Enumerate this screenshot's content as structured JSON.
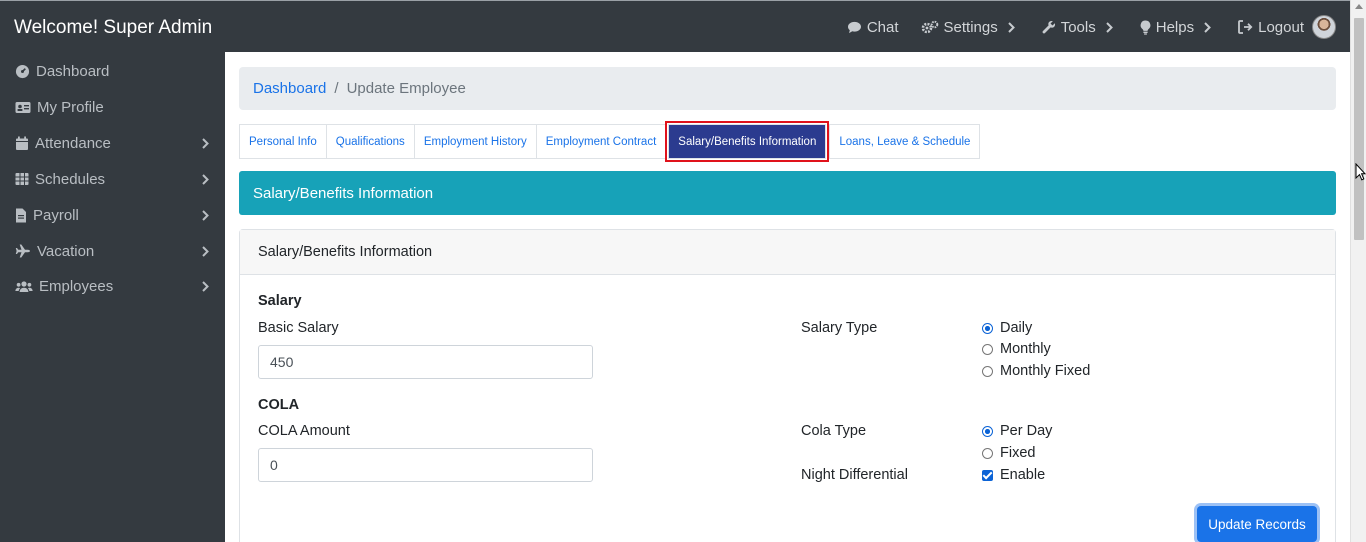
{
  "topbar": {
    "brand": "Welcome! Super Admin",
    "nav": [
      {
        "label": "Chat",
        "icon": "chat-icon",
        "has_caret": false
      },
      {
        "label": "Settings",
        "icon": "gears-icon",
        "has_caret": true
      },
      {
        "label": "Tools",
        "icon": "wrench-icon",
        "has_caret": true
      },
      {
        "label": "Helps",
        "icon": "lightbulb-icon",
        "has_caret": true
      },
      {
        "label": "Logout",
        "icon": "logout-icon",
        "has_caret": false
      }
    ]
  },
  "sidebar": {
    "items": [
      {
        "label": "Dashboard",
        "icon": "dashboard-icon",
        "has_chevron": false
      },
      {
        "label": "My Profile",
        "icon": "id-card-icon",
        "has_chevron": false
      },
      {
        "label": "Attendance",
        "icon": "calendar-icon",
        "has_chevron": true
      },
      {
        "label": "Schedules",
        "icon": "table-icon",
        "has_chevron": true
      },
      {
        "label": "Payroll",
        "icon": "file-icon",
        "has_chevron": true
      },
      {
        "label": "Vacation",
        "icon": "plane-icon",
        "has_chevron": true
      },
      {
        "label": "Employees",
        "icon": "users-icon",
        "has_chevron": true
      }
    ]
  },
  "breadcrumb": {
    "link": "Dashboard",
    "separator": "/",
    "current": "Update Employee"
  },
  "tabs": [
    {
      "label": "Personal Info",
      "active": false
    },
    {
      "label": "Qualifications",
      "active": false
    },
    {
      "label": "Employment History",
      "active": false
    },
    {
      "label": "Employment Contract",
      "active": false
    },
    {
      "label": "Salary/Benefits Information",
      "active": true
    },
    {
      "label": "Loans, Leave & Schedule",
      "active": false
    }
  ],
  "banner": {
    "title": "Salary/Benefits Information"
  },
  "card": {
    "header": "Salary/Benefits Information",
    "salary": {
      "heading": "Salary",
      "basic_label": "Basic Salary",
      "basic_value": "450",
      "type_label": "Salary Type",
      "type_options": [
        "Daily",
        "Monthly",
        "Monthly Fixed"
      ],
      "type_selected": "Daily"
    },
    "cola": {
      "heading": "COLA",
      "amount_label": "COLA Amount",
      "amount_value": "0",
      "type_label": "Cola Type",
      "type_options": [
        "Per Day",
        "Fixed"
      ],
      "type_selected": "Per Day"
    },
    "night_diff": {
      "label": "Night Differential",
      "option": "Enable",
      "checked": true
    },
    "submit_label": "Update Records"
  },
  "colors": {
    "topbar_bg": "#343a40",
    "accent": "#1a73e8",
    "banner_bg": "#17a2b8",
    "active_tab_bg": "#2b3b8f",
    "highlight_outline": "#e0121b"
  }
}
